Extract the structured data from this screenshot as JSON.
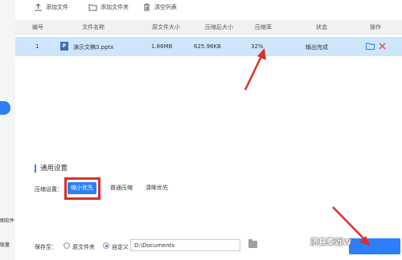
{
  "sidebar": {
    "label_1": "图软件",
    "label_2": "版量"
  },
  "toolbar": {
    "add_file": "添加文件",
    "add_folder": "添加文件夹",
    "clear_list": "清空列表"
  },
  "table": {
    "headers": {
      "index": "编号",
      "name": "文件名称",
      "orig_size": "原文件大小",
      "compressed_size": "压缩后大小",
      "ratio": "压缩率",
      "status": "状态",
      "action": "操作"
    },
    "rows": [
      {
        "index": "1",
        "file_icon_letter": "P",
        "name": "演示文稿3.pptx",
        "orig_size": "1.86MB",
        "compressed_size": "625.96KB",
        "ratio": "32%",
        "status": "输出完成"
      }
    ]
  },
  "settings": {
    "title": "通用设置",
    "compress_label": "压缩设置：",
    "options": [
      "缩小优先",
      "普通压缩",
      "清晰优先"
    ],
    "selected_option": "缩小优先",
    "save_label": "保存至：",
    "radio_original": "原文件夹",
    "radio_custom": "自定义",
    "save_path": "D:\\Documents"
  },
  "watermark": "济县泰近W",
  "colors": {
    "accent": "#2d7ff9",
    "selected_row": "#cde6fb",
    "annotation_red": "#d9302c"
  }
}
